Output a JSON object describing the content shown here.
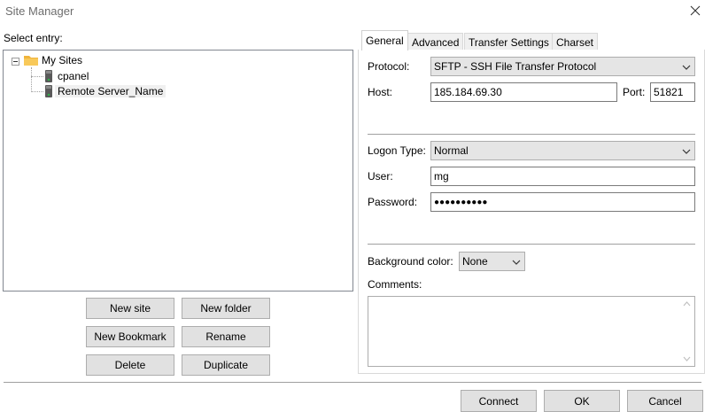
{
  "window": {
    "title": "Site Manager",
    "close_icon": "close-icon"
  },
  "tree": {
    "label": "Select entry:",
    "root": {
      "label": "My Sites",
      "icon": "folder-icon"
    },
    "children": [
      {
        "label": "cpanel",
        "icon": "server-icon"
      },
      {
        "label": "Remote Server_Name",
        "icon": "server-icon"
      }
    ]
  },
  "buttons": {
    "new_site": "New site",
    "new_folder": "New folder",
    "new_bookmark": "New Bookmark",
    "rename": "Rename",
    "delete": "Delete",
    "duplicate": "Duplicate"
  },
  "tabs": [
    {
      "label": "General",
      "active": true
    },
    {
      "label": "Advanced",
      "active": false
    },
    {
      "label": "Transfer Settings",
      "active": false
    },
    {
      "label": "Charset",
      "active": false
    }
  ],
  "general": {
    "protocol_label": "Protocol:",
    "protocol_value": "SFTP - SSH File Transfer Protocol",
    "host_label": "Host:",
    "host_value": "185.184.69.30",
    "port_label": "Port:",
    "port_value": "51821",
    "logon_label": "Logon Type:",
    "logon_value": "Normal",
    "user_label": "User:",
    "user_value": "mg",
    "password_label": "Password:",
    "password_value": "●●●●●●●●●●",
    "bgcolor_label": "Background color:",
    "bgcolor_value": "None",
    "comments_label": "Comments:",
    "comments_value": ""
  },
  "footer": {
    "connect": "Connect",
    "ok": "OK",
    "cancel": "Cancel"
  },
  "colors": {
    "folder": "#f0b43c",
    "server": "#4a4a4a",
    "server_light": "#2fb34a"
  }
}
